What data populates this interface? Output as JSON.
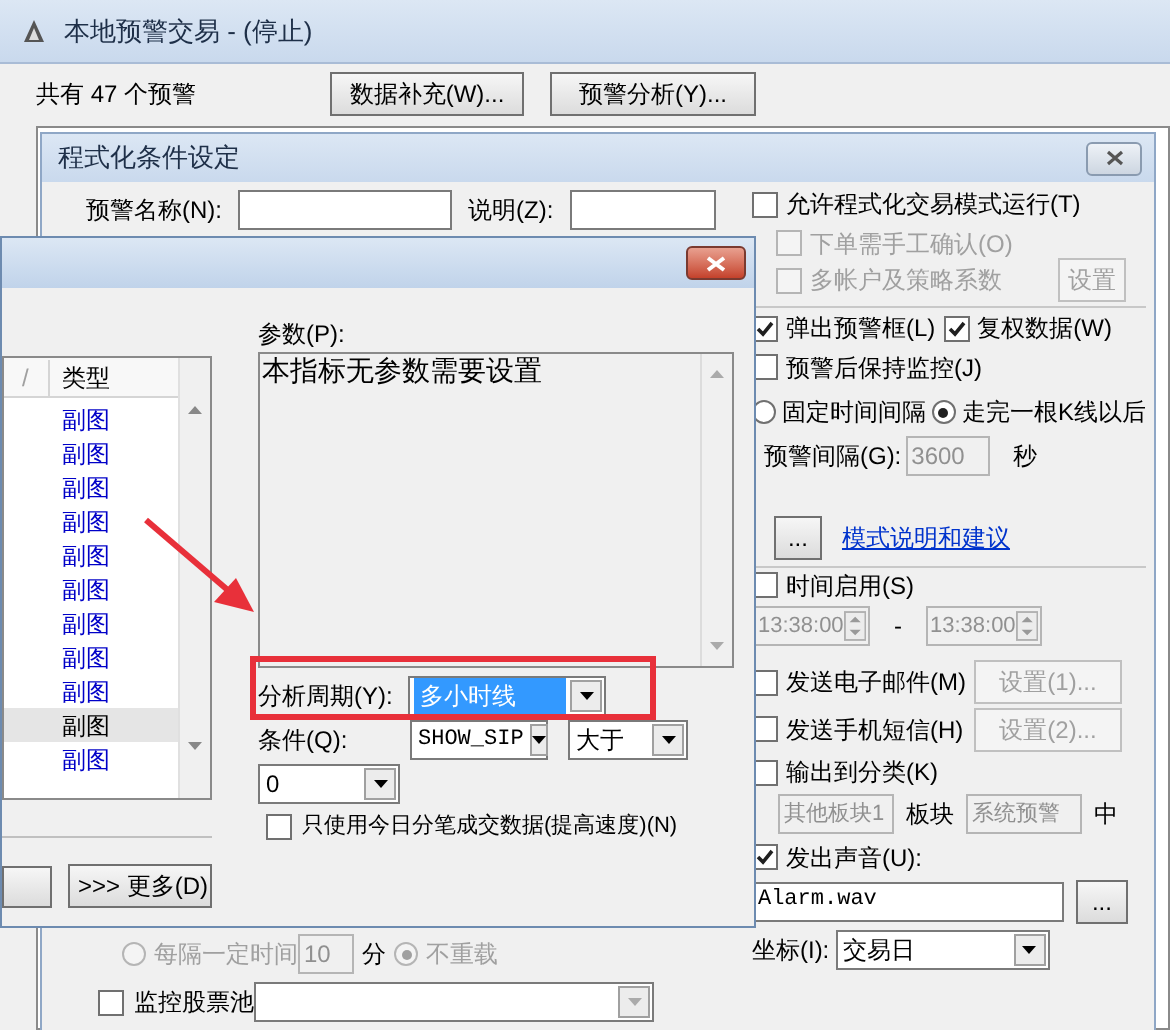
{
  "main_window": {
    "title": "本地预警交易 - (停止)",
    "alert_count": "共有 47 个预警",
    "buttons": [
      {
        "label": "数据补充(W)..."
      },
      {
        "label": "预警分析(Y)..."
      }
    ]
  },
  "condition_dialog": {
    "title": "程式化条件设定",
    "name_label": "预警名称(N):",
    "desc_label": "说明(Z):",
    "program_mode": {
      "label": "允许程式化交易模式运行(T)",
      "checked": false
    },
    "manual_confirm": {
      "label": "下单需手工确认(O)",
      "checked": false,
      "disabled": true
    },
    "multi_account": {
      "label": "多帐户及策略系数",
      "checked": false,
      "disabled": true,
      "button": "设置"
    },
    "popup": {
      "label": "弹出预警框(L)",
      "checked": true
    },
    "adjusted": {
      "label": "复权数据(W)",
      "checked": true
    },
    "keep_monitor": {
      "label": "预警后保持监控(J)",
      "checked": false
    },
    "interval_mode": [
      {
        "label": "固定时间间隔",
        "selected": false
      },
      {
        "label": "走完一根K线以后",
        "selected": true
      }
    ],
    "interval": {
      "label": "预警间隔(G):",
      "value": "3600",
      "unit": "秒",
      "disabled": true
    },
    "dots_button": "...",
    "help_link": "模式说明和建议",
    "time_enable": {
      "label": "时间启用(S)",
      "checked": false
    },
    "time_range": {
      "start": "13:38:00",
      "separator": "-",
      "end": "13:38:00",
      "disabled": true
    },
    "email": {
      "label": "发送电子邮件(M)",
      "checked": false,
      "button": "设置(1)...",
      "disabled": true
    },
    "sms": {
      "label": "发送手机短信(H)",
      "checked": false,
      "button": "设置(2)...",
      "disabled": true
    },
    "output": {
      "label": "输出到分类(K)",
      "checked": false,
      "block": "其他板块1",
      "block_label": "板块",
      "category": "系统预警",
      "suffix": "中"
    },
    "sound": {
      "label": "发出声音(U):",
      "checked": true,
      "file": "Alarm.wav",
      "browse": "..."
    },
    "axis": {
      "label": "坐标(I):",
      "value": "交易日"
    },
    "reload": {
      "options": [
        {
          "label": "每隔一定时间",
          "selected": false
        },
        {
          "label": "不重载",
          "selected": true
        }
      ],
      "minutes": "10",
      "unit": "分",
      "disabled": true
    },
    "stock_pool": {
      "label": "监控股票池",
      "checked": false
    }
  },
  "indicator_dialog": {
    "columns": [
      {
        "label": "/"
      },
      {
        "label": "类型"
      }
    ],
    "rows": [
      {
        "type": "副图",
        "selected": false
      },
      {
        "type": "副图",
        "selected": false
      },
      {
        "type": "副图",
        "selected": false
      },
      {
        "type": "副图",
        "selected": false
      },
      {
        "type": "副图",
        "selected": false
      },
      {
        "type": "副图",
        "selected": false
      },
      {
        "type": "副图",
        "selected": false
      },
      {
        "type": "副图",
        "selected": false
      },
      {
        "type": "副图",
        "selected": false
      },
      {
        "type": "副图",
        "selected": true
      },
      {
        "type": "副图",
        "selected": false
      }
    ],
    "params_label": "参数(P):",
    "params_text": "本指标无参数需要设置",
    "period": {
      "label": "分析周期(Y):",
      "value": "多小时线"
    },
    "condition": {
      "label": "条件(Q):",
      "values": [
        "SHOW_SIP",
        "大于",
        "0"
      ]
    },
    "tick_only": {
      "label": "只使用今日分笔成交数据(提高速度)(N)",
      "checked": false
    },
    "more_button": ">>> 更多(D)"
  }
}
